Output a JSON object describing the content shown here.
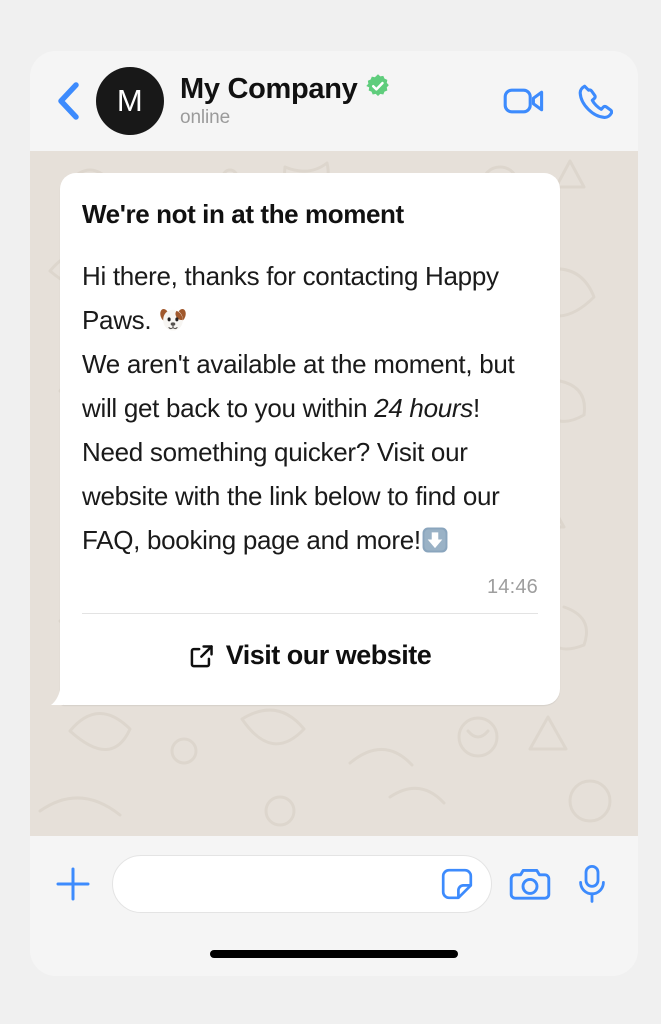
{
  "app": "whatsapp-chat",
  "colors": {
    "page_background": "#f0f0f0",
    "phone_surface": "#f5f5f5",
    "chat_background": "#e6e0d9",
    "doodle": "#d8d1c7",
    "accent_blue": "#3d8bfd",
    "verified_green": "#5fcd7c",
    "bubble": "#ffffff",
    "text_primary": "#111111",
    "text_muted": "#9b9b9b"
  },
  "header": {
    "back_icon": "chevron-left-icon",
    "avatar_initial": "M",
    "contact_name": "My Company",
    "verified": true,
    "verified_icon": "verified-badge-icon",
    "status": "online",
    "video_call_icon": "video-camera-icon",
    "voice_call_icon": "phone-icon"
  },
  "message": {
    "title": "We're not in at the moment",
    "body_part_1": "Hi there, thanks for contacting Happy Paws. ",
    "dog_emoji": "dog-face-emoji",
    "body_part_2": "\nWe aren't available at the moment, but will get back to you within ",
    "emphasis": "24 hours",
    "body_part_3": "!\nNeed something quicker? Visit our website with the link below to find our FAQ, booking page and more!",
    "down_arrow_emoji": "down-arrow-emoji",
    "full_text": "Hi there, thanks for contacting Happy Paws. 🐶\nWe aren't available at the moment, but will get back to you within 24 hours!\nNeed something quicker? Visit our website with the link below to find our FAQ, booking page and more!⬇️",
    "timestamp": "14:46",
    "cta_label": "Visit our website",
    "cta_icon": "external-link-icon"
  },
  "composer": {
    "attach_icon": "plus-icon",
    "input_value": "",
    "input_placeholder": "",
    "sticker_icon": "sticker-icon",
    "camera_icon": "camera-icon",
    "mic_icon": "microphone-icon"
  },
  "system": {
    "home_indicator": "home-indicator-bar"
  }
}
